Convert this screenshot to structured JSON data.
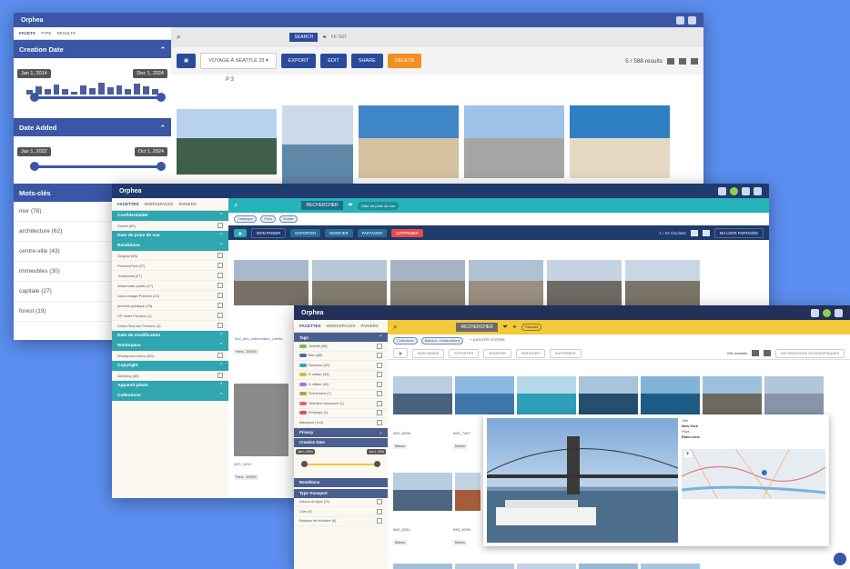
{
  "app_name": "Orphea",
  "w1": {
    "tabs": [
      "FACETS",
      "TYPE",
      "RESULTS"
    ],
    "creation_date_label": "Creation Date",
    "creation_range": [
      "Jan 1, 2014",
      "Dec 1, 2024"
    ],
    "date_added_label": "Date Added",
    "added_range": [
      "Jan 1, 2022",
      "Oct 1, 2024"
    ],
    "keywords_label": "Mots-clés",
    "keywords": [
      "mer (78)",
      "architecture (62)",
      "centre-ville (43)",
      "immeubles (30)",
      "capitale (27)",
      "forest (19)"
    ],
    "search_button": "SEARCH",
    "filter_label": "FILTER",
    "selection_label": "VOYAGE À SEATTLE",
    "selection_count": "33",
    "buttons": {
      "export": "EXPORT",
      "edit": "EDIT",
      "share": "SHARE",
      "delete": "DELETE"
    },
    "results": "5 / 588 results",
    "group_label": "P 3"
  },
  "w2": {
    "tabs": [
      "FACETTES",
      "WORKSPACES",
      "PANIERS"
    ],
    "search_button": "RECHERCHER",
    "date_chip": "Date de prise de vue",
    "chips": [
      "Catalogue",
      "Paris",
      "Seattle"
    ],
    "sections": [
      {
        "title": "Confidentialité",
        "rows": [
          "Secret (83)"
        ]
      },
      {
        "title": "Date de prise de vue",
        "rows": []
      },
      {
        "title": "Renditions",
        "rows": [
          "Original (83)",
          "PreviewPost (27)",
          "Thumbnail (27)",
          "Watermark public (27)",
          "Users image Preview (23)",
          "preview publique (23)",
          "HP vidéo Preview (1)",
          "Vidéo Resume Preview (1)"
        ]
      },
      {
        "title": "Date de modification",
        "rows": []
      },
      {
        "title": "Workspace",
        "rows": [
          "Workspace Demo (83)"
        ]
      },
      {
        "title": "Copyright",
        "rows": [
          "Alchemy (83)"
        ]
      },
      {
        "title": "Appareil photo",
        "rows": []
      },
      {
        "title": "Collections",
        "rows": []
      }
    ],
    "buttons": {
      "panier": "MON PANIER",
      "export": "EXPORTER",
      "edit": "MODIFIER",
      "share": "PARTAGER",
      "delete": "SUPPRIMER"
    },
    "results": "1 / 83 résultats",
    "view_label": "MA LISTE PARTAGÉE",
    "captions": [
      "Tour_des_cathedrales_Lutetia",
      "IMG_3208"
    ],
    "place_tag": "Paris - 2EM00"
  },
  "w3": {
    "tabs": [
      "FACETTES",
      "WORKSPACES",
      "PANIERS"
    ],
    "search_button": "RECHERCHER",
    "search_chip": "Français",
    "chips": [
      "Collections",
      "Bateaux, embarcations"
    ],
    "add_criterion": "+ AJOUTER CRITÈRE",
    "tags_title": "Tags",
    "tags": [
      {
        "label": "Vedette (88)",
        "color": "#6fbf4a"
      },
      {
        "label": "Bleu (88)",
        "color": "#4a66b8"
      },
      {
        "label": "Nouveau (62)",
        "color": "#2fa6b0"
      },
      {
        "label": "À valider (45)",
        "color": "#e8b23a"
      },
      {
        "label": "À utiliser (30)",
        "color": "#9f7bd6"
      },
      {
        "label": "Événement (7)",
        "color": "#c89a2f"
      },
      {
        "label": "Sélection ressource (1)",
        "color": "#e85a8a"
      },
      {
        "label": "Embargo (1)",
        "color": "#e84a4a"
      },
      {
        "label": "Marqueur (144)",
        "color": ""
      }
    ],
    "privacy_title": "Privacy",
    "creation_title": "Creation Date",
    "creation_range": [
      "Jan 1, 2004",
      "Jan 1, 2024"
    ],
    "renditions_title": "Renditions",
    "transport_title": "Type Transport",
    "transport": [
      "Avions de ligne (11)",
      "Cars (9)",
      "Bateaux de croisière (6)",
      "Ferry (5)"
    ],
    "buttons": {
      "panier": "MON PANIER",
      "export": "EXPORTER",
      "edit": "MODIFIER",
      "share": "PARTAGER",
      "delete": "SUPPRIMER"
    },
    "results": "208 résultats",
    "info_label": "INFORMATIONS GÉOGRAPHIQUES",
    "captions": [
      "IMG_6098",
      "IMG_7467",
      "IMG_6281",
      "IMG_6396"
    ],
    "tag_label": "Bateau",
    "detail": {
      "city_label": "Ville",
      "city": "New York",
      "country_label": "Pays",
      "country": "États-Unis"
    }
  }
}
